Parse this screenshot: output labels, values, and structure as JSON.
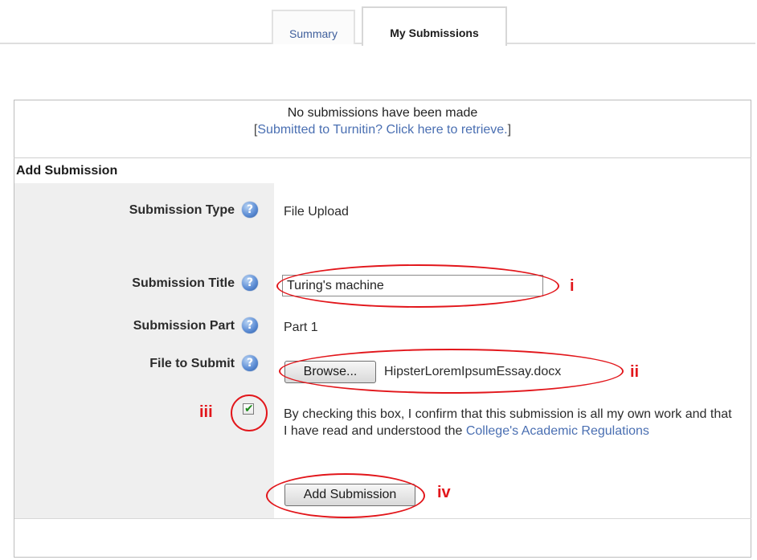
{
  "tabs": {
    "summary": "Summary",
    "my_submissions": "My Submissions"
  },
  "notice": {
    "no_submissions": "No submissions have been made",
    "retrieve_open": "[",
    "retrieve_link": "Submitted to Turnitin? Click here to retrieve.",
    "retrieve_close": "]"
  },
  "section": {
    "title": "Add Submission"
  },
  "fields": {
    "type_label": "Submission Type",
    "type_value": "File Upload",
    "title_label": "Submission Title",
    "title_value": "Turing's machine",
    "part_label": "Submission Part",
    "part_value": "Part 1",
    "file_label": "File to Submit",
    "browse_label": "Browse...",
    "file_name": "HipsterLoremIpsumEssay.docx"
  },
  "confirm": {
    "text": "By checking this box, I confirm that this submission is all my own work and that I have read and understood the ",
    "link": "College's Academic Regulations",
    "checked": true
  },
  "add_button": "Add Submission",
  "help_glyph": "?",
  "annotations": {
    "i": "i",
    "ii": "ii",
    "iii": "iii",
    "iv": "iv",
    "color": "#e2161b"
  }
}
